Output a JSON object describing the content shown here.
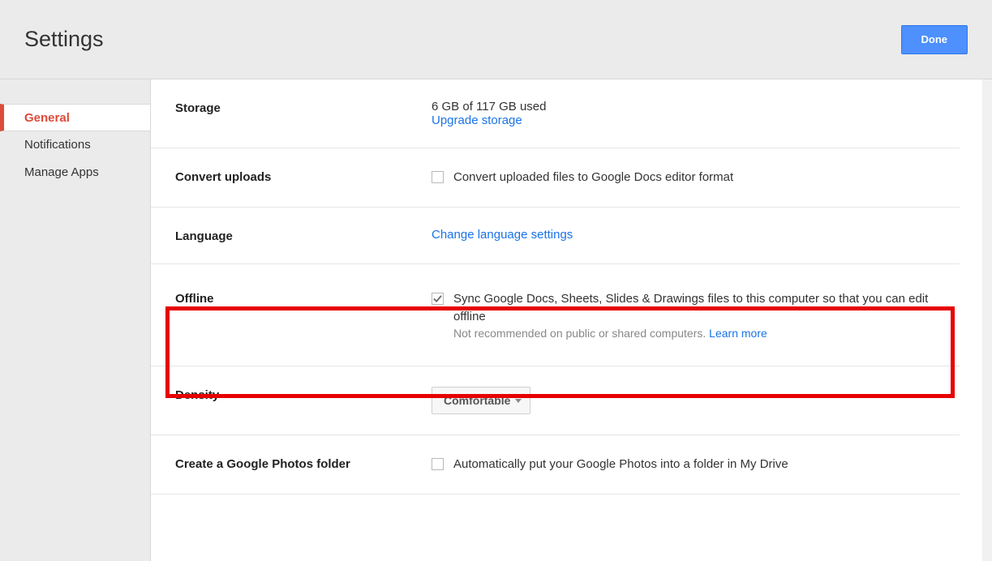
{
  "header": {
    "title": "Settings",
    "done_label": "Done"
  },
  "sidebar": {
    "items": [
      {
        "label": "General",
        "active": true
      },
      {
        "label": "Notifications",
        "active": false
      },
      {
        "label": "Manage Apps",
        "active": false
      }
    ]
  },
  "storage": {
    "label": "Storage",
    "usage": "6 GB of 117 GB used",
    "upgrade_link": "Upgrade storage"
  },
  "convert": {
    "label": "Convert uploads",
    "checkbox_label": "Convert uploaded files to Google Docs editor format",
    "checked": false
  },
  "language": {
    "label": "Language",
    "link": "Change language settings"
  },
  "offline": {
    "label": "Offline",
    "checkbox_label": "Sync Google Docs, Sheets, Slides & Drawings files to this computer so that you can edit offline",
    "checked": true,
    "hint": "Not recommended on public or shared computers.",
    "learn_more": "Learn more"
  },
  "density": {
    "label": "Density",
    "value": "Comfortable"
  },
  "photos": {
    "label": "Create a Google Photos folder",
    "checkbox_label": "Automatically put your Google Photos into a folder in My Drive",
    "checked": false
  }
}
